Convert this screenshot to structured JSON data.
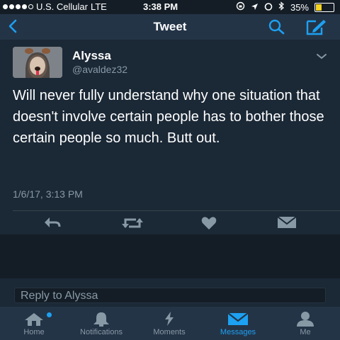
{
  "status": {
    "carrier": "U.S. Cellular",
    "network": "LTE",
    "time": "3:38 PM",
    "battery": "35%",
    "battery_level": 0.35
  },
  "nav": {
    "title": "Tweet"
  },
  "tweet": {
    "author_name": "Alyssa",
    "author_handle": "@avaldez32",
    "text": "Will never fully understand why one situation that doesn't involve certain people has to bother those certain people so much. Butt out.",
    "timestamp": "1/6/17, 3:13 PM"
  },
  "reply": {
    "placeholder": "Reply to Alyssa"
  },
  "tabs": [
    {
      "label": "Home",
      "icon": "home-icon"
    },
    {
      "label": "Notifications",
      "icon": "bell-icon"
    },
    {
      "label": "Moments",
      "icon": "lightning-icon"
    },
    {
      "label": "Messages",
      "icon": "envelope-icon"
    },
    {
      "label": "Me",
      "icon": "person-icon"
    }
  ],
  "colors": {
    "accent": "#1da1f2",
    "background": "#141d26",
    "card": "#1b2836",
    "bar": "#243447",
    "muted": "#8899a6"
  }
}
